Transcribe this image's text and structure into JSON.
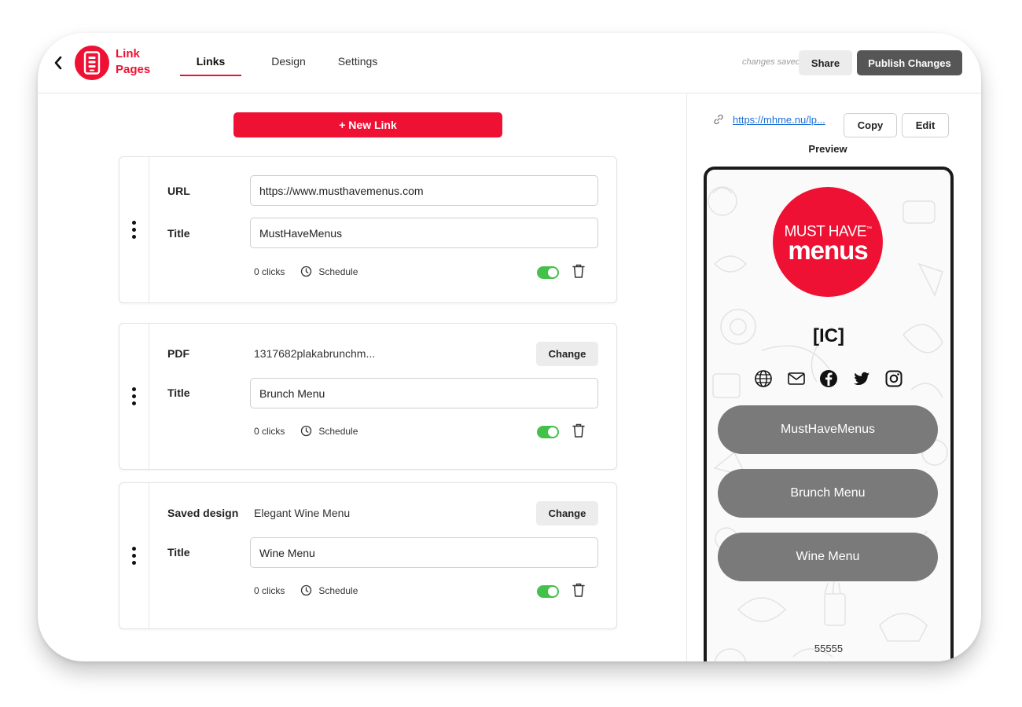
{
  "header": {
    "app_name": "Link Pages",
    "tabs": [
      {
        "label": "Links",
        "active": true
      },
      {
        "label": "Design",
        "active": false
      },
      {
        "label": "Settings",
        "active": false
      }
    ],
    "save_status": "changes saved",
    "share_label": "Share",
    "publish_label": "Publish Changes"
  },
  "editor": {
    "new_link_label": "+ New Link",
    "cards": [
      {
        "type_label": "URL",
        "type_value": "https://www.musthavemenus.com",
        "title_label": "Title",
        "title_value": "MustHaveMenus",
        "clicks": "0 clicks",
        "schedule_label": "Schedule",
        "enabled": true
      },
      {
        "type_label": "PDF",
        "type_value": "1317682plakabrunchm...",
        "change_label": "Change",
        "title_label": "Title",
        "title_value": "Brunch Menu",
        "clicks": "0 clicks",
        "schedule_label": "Schedule",
        "enabled": true
      },
      {
        "type_label": "Saved design",
        "type_value": "Elegant Wine Menu",
        "change_label": "Change",
        "title_label": "Title",
        "title_value": "Wine Menu",
        "clicks": "0 clicks",
        "schedule_label": "Schedule",
        "enabled": true
      }
    ]
  },
  "preview": {
    "url": "https://mhme.nu/lp...",
    "copy_label": "Copy",
    "edit_label": "Edit",
    "label": "Preview",
    "phone": {
      "logo_top": "MUST HAVE",
      "logo_tm": "™",
      "logo_bottom": "menus",
      "profile_name": "[IC]",
      "social_icons": [
        "globe-icon",
        "mail-icon",
        "facebook-icon",
        "twitter-icon",
        "instagram-icon"
      ],
      "buttons": [
        "MustHaveMenus",
        "Brunch Menu",
        "Wine Menu"
      ],
      "footer": "55555"
    }
  },
  "colors": {
    "brand_red": "#ee1133",
    "toggle_on": "#43c14a",
    "publish_bg": "#565656",
    "phone_button": "#7a7a7a",
    "link_blue": "#1e6fd9"
  }
}
